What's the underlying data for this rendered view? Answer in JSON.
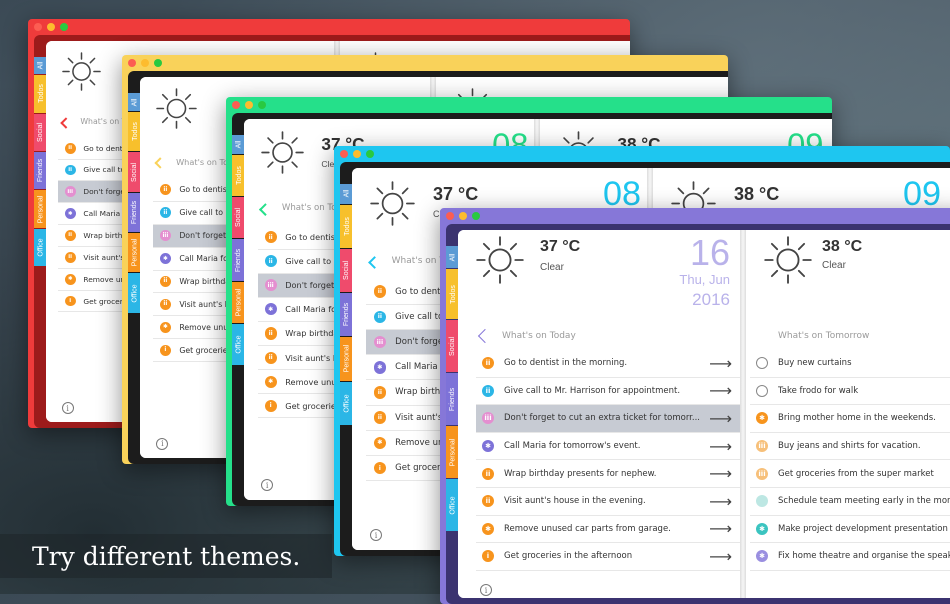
{
  "caption": "Try different themes.",
  "tabs": [
    "All",
    "Todos",
    "Social",
    "Friends",
    "Personal",
    "Office"
  ],
  "tab_colors": [
    "#5b9bd5",
    "#f7c02c",
    "#ef4b6c",
    "#7d72d8",
    "#f7941d",
    "#2bb6e6"
  ],
  "today": {
    "temp": "37 °C",
    "cond": "Clear",
    "day": "16",
    "weekday": "Thu, Jun",
    "year": "2016",
    "title": "What's on Today",
    "items": [
      {
        "text": "Go to dentist in the morning.",
        "icon": "ii",
        "color": "#f7941d"
      },
      {
        "text": "Give call to Mr. Harrison for appointment.",
        "icon": "ii",
        "color": "#2bb6e6"
      },
      {
        "text": "Don't forget to cut an extra ticket for tomorr...",
        "icon": "iii",
        "color": "#e48fd0",
        "selected": true
      },
      {
        "text": "Call Maria for tomorrow's event.",
        "icon": "star",
        "color": "#7d72d8"
      },
      {
        "text": "Wrap birthday presents for nephew.",
        "icon": "ii",
        "color": "#f7941d"
      },
      {
        "text": "Visit aunt's house in the evening.",
        "icon": "ii",
        "color": "#f7941d"
      },
      {
        "text": "Remove unused car parts from garage.",
        "icon": "star",
        "color": "#f7941d"
      },
      {
        "text": "Get groceries in the afternoon",
        "icon": "i",
        "color": "#f7941d"
      }
    ]
  },
  "tomorrow": {
    "temp": "38 °C",
    "cond": "Clear",
    "title": "What's on Tomorrow",
    "items": [
      {
        "text": "Buy new curtains",
        "icon": "",
        "color": ""
      },
      {
        "text": "Take frodo for walk",
        "icon": "",
        "color": ""
      },
      {
        "text": "Bring mother home in the weekends.",
        "icon": "star",
        "color": "#f7941d"
      },
      {
        "text": "Buy jeans and shirts for vacation.",
        "icon": "iii",
        "color": "#f7c07a"
      },
      {
        "text": "Get groceries from the super market",
        "icon": "iii",
        "color": "#f7c07a"
      },
      {
        "text": "Schedule team meeting early in the morning.",
        "icon": "",
        "color": "#bde7e3"
      },
      {
        "text": "Make project development presentation for...",
        "icon": "star",
        "color": "#3bc4c0"
      },
      {
        "text": "Fix home theatre and organise the speakers.",
        "icon": "star",
        "color": "#9a8fe0"
      }
    ]
  },
  "back_windows": [
    {
      "theme": "red",
      "accent": "#ef3b3b",
      "frame": "#9d1b1b",
      "tomorrow_day": ""
    },
    {
      "theme": "yellow",
      "accent": "#f9d25a",
      "frame": "#1c1c1c",
      "tomorrow_day": ""
    },
    {
      "theme": "green",
      "accent": "#25e08a",
      "frame": "#1c1c1c",
      "temp": "37 °C",
      "temp2": "38 °C",
      "cond": "Clear",
      "today_day": "08",
      "tomorrow_day": "09"
    },
    {
      "theme": "cyan",
      "accent": "#1ec6f0",
      "frame": "#1c1c1c",
      "temp": "37 °C",
      "temp2": "38 °C",
      "cond": "Clear",
      "today_day": "08",
      "tomorrow_day": "09"
    }
  ],
  "front_accent": "#8677d8",
  "front_frame": "#3b3370",
  "date_color": "#b9b2ea"
}
